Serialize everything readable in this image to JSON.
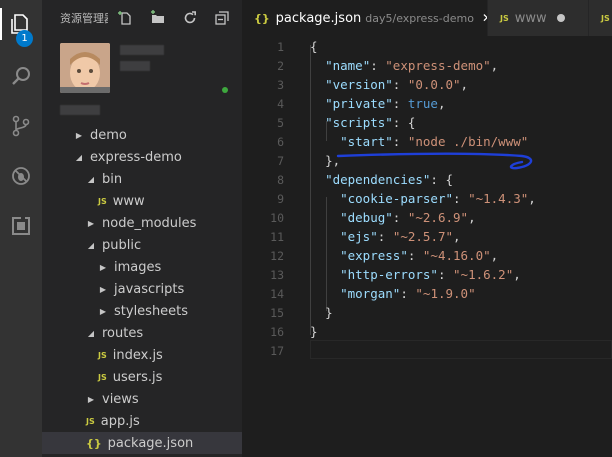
{
  "activity_bar": {
    "explorer_badge": "1",
    "icons": [
      "files-icon",
      "search-icon",
      "source-control-icon",
      "debug-icon",
      "extensions-icon"
    ]
  },
  "sidebar": {
    "title": "资源管理器",
    "tree": [
      {
        "label": "demo",
        "type": "folder",
        "expanded": false,
        "depth": 0
      },
      {
        "label": "express-demo",
        "type": "folder",
        "expanded": true,
        "depth": 0
      },
      {
        "label": "bin",
        "type": "folder",
        "expanded": true,
        "depth": 1
      },
      {
        "label": "www",
        "type": "js",
        "depth": 2
      },
      {
        "label": "node_modules",
        "type": "folder",
        "expanded": false,
        "depth": 1
      },
      {
        "label": "public",
        "type": "folder",
        "expanded": true,
        "depth": 1
      },
      {
        "label": "images",
        "type": "folder",
        "expanded": false,
        "depth": 2
      },
      {
        "label": "javascripts",
        "type": "folder",
        "expanded": false,
        "depth": 2
      },
      {
        "label": "stylesheets",
        "type": "folder",
        "expanded": false,
        "depth": 2
      },
      {
        "label": "routes",
        "type": "folder",
        "expanded": true,
        "depth": 1
      },
      {
        "label": "index.js",
        "type": "js",
        "depth": 2
      },
      {
        "label": "users.js",
        "type": "js",
        "depth": 2
      },
      {
        "label": "views",
        "type": "folder",
        "expanded": false,
        "depth": 1
      },
      {
        "label": "app.js",
        "type": "js",
        "depth": 1
      },
      {
        "label": "package.json",
        "type": "json",
        "depth": 1,
        "selected": true
      }
    ]
  },
  "tabs": [
    {
      "icon": "{}",
      "label": "package.json",
      "description": "day5/express-demo",
      "active": true
    },
    {
      "icon": "JS",
      "label": "www",
      "dirty": true
    },
    {
      "icon": "JS",
      "label": ""
    }
  ],
  "editor": {
    "lines": [
      {
        "n": "1",
        "t": "{"
      },
      {
        "n": "2",
        "t": "  \"name\": \"express-demo\","
      },
      {
        "n": "3",
        "t": "  \"version\": \"0.0.0\","
      },
      {
        "n": "4",
        "t": "  \"private\": true,"
      },
      {
        "n": "5",
        "t": "  \"scripts\": {"
      },
      {
        "n": "6",
        "t": "    \"start\": \"node ./bin/www\""
      },
      {
        "n": "7",
        "t": "  },"
      },
      {
        "n": "8",
        "t": "  \"dependencies\": {"
      },
      {
        "n": "9",
        "t": "    \"cookie-parser\": \"~1.4.3\","
      },
      {
        "n": "10",
        "t": "    \"debug\": \"~2.6.9\","
      },
      {
        "n": "11",
        "t": "    \"ejs\": \"~2.5.7\","
      },
      {
        "n": "12",
        "t": "    \"express\": \"~4.16.0\","
      },
      {
        "n": "13",
        "t": "    \"http-errors\": \"~1.6.2\","
      },
      {
        "n": "14",
        "t": "    \"morgan\": \"~1.9.0\""
      },
      {
        "n": "15",
        "t": "  }"
      },
      {
        "n": "16",
        "t": "}"
      },
      {
        "n": "17",
        "t": ""
      }
    ]
  },
  "colors": {
    "key": "#9cdcfe",
    "string": "#ce9178",
    "boolean": "#569cd6",
    "annotation": "#1e3fd8",
    "badge": "#007acc"
  }
}
